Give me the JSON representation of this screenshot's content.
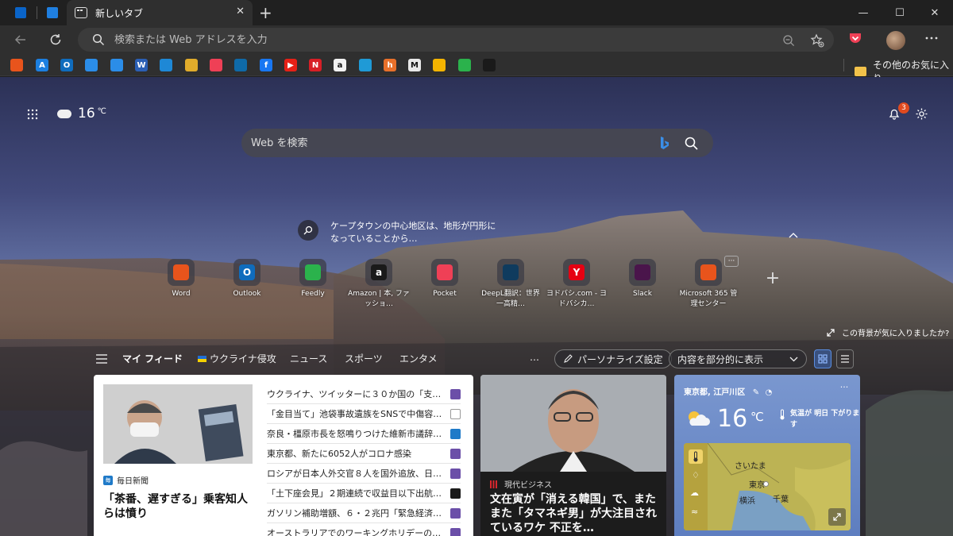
{
  "tab": {
    "title": "新しいタブ",
    "close": "✕",
    "new": "+"
  },
  "window": {
    "minimize": "—",
    "maximize": "☐",
    "close": "✕"
  },
  "address": {
    "placeholder": "検索または Web アドレスを入力"
  },
  "favorites": {
    "items": [
      {
        "name": "office",
        "letter": "",
        "color": "#e8541c"
      },
      {
        "name": "azure",
        "letter": "A",
        "color": "#1c7fe0"
      },
      {
        "name": "outlook",
        "letter": "O",
        "color": "#0f6cbd"
      },
      {
        "name": "onedrive-1",
        "letter": "",
        "color": "#2b8de8"
      },
      {
        "name": "onedrive-2",
        "letter": "",
        "color": "#2b8de8"
      },
      {
        "name": "word",
        "letter": "W",
        "color": "#2b5fb4"
      },
      {
        "name": "remote-desktop",
        "letter": "",
        "color": "#1e88d6"
      },
      {
        "name": "slack",
        "letter": "",
        "color": "#e1ac2b"
      },
      {
        "name": "pocket",
        "letter": "",
        "color": "#ef4056"
      },
      {
        "name": "deepl",
        "letter": "",
        "color": "#0f6aa8"
      },
      {
        "name": "facebook",
        "letter": "f",
        "color": "#1877f2"
      },
      {
        "name": "youtube",
        "letter": "▶",
        "color": "#e62117"
      },
      {
        "name": "netflix",
        "letter": "N",
        "color": "#d81f26"
      },
      {
        "name": "amazon",
        "letter": "a",
        "color": "#f2f2f2"
      },
      {
        "name": "kindle",
        "letter": "",
        "color": "#1f9ad6"
      },
      {
        "name": "hatena",
        "letter": "h",
        "color": "#e8702a"
      },
      {
        "name": "gmail",
        "letter": "M",
        "color": "#e8e8e8"
      },
      {
        "name": "google-drive",
        "letter": "",
        "color": "#f4b400"
      },
      {
        "name": "feedly",
        "letter": "",
        "color": "#2bb24c"
      },
      {
        "name": "microphone",
        "letter": "",
        "color": "#1a1a1a"
      }
    ],
    "other_label": "その他のお気に入り"
  },
  "ntp": {
    "weather_temp": "16",
    "weather_unit": "℃",
    "notification_count": "3",
    "search_placeholder": "Web を検索",
    "image_caption": "ケープタウンの中心地区は、地形が円形になっていることから…",
    "liked_text": "この背景が気に入りましたか?",
    "tiles": [
      {
        "label": "Word",
        "letter": "",
        "color": "#e8541c"
      },
      {
        "label": "Outlook",
        "letter": "O",
        "color": "#0f6cbd"
      },
      {
        "label": "Feedly",
        "letter": "",
        "color": "#2bb24c"
      },
      {
        "label": "Amazon | 本, ファッショ…",
        "letter": "a",
        "color": "#1a1a1a"
      },
      {
        "label": "Pocket",
        "letter": "",
        "color": "#ef4056"
      },
      {
        "label": "DeepL翻訳：世界一高精…",
        "letter": "",
        "color": "#0f3b5e"
      },
      {
        "label": "ヨドバシ.com - ヨドバシカ…",
        "letter": "Y",
        "color": "#e60012"
      },
      {
        "label": "Slack",
        "letter": "",
        "color": "#4a154b"
      },
      {
        "label": "Microsoft 365 管理センター",
        "letter": "",
        "color": "#e8541c"
      }
    ]
  },
  "feed": {
    "nav": [
      "マイ フィード",
      "ウクライナ侵攻",
      "ニュース",
      "スポーツ",
      "エンタメ"
    ],
    "more": "…",
    "personalize": "パーソナライズ設定",
    "content_select": "内容を部分的に表示"
  },
  "card_main": {
    "source": "毎日新聞",
    "headline": "「茶番、遅すぎる」乗客知人らは憤り",
    "list": [
      {
        "title": "ウクライナ、ツイッターに３０か国の「支…",
        "src_color": "#6b4fa8"
      },
      {
        "title": "「金目当て」池袋事故遺族をSNSで中傷容…",
        "src_color": "#ffffff"
      },
      {
        "title": "奈良・橿原市長を怒鳴りつけた維新市議辞…",
        "src_color": "#1f7ac8"
      },
      {
        "title": "東京都、新たに6052人がコロナ感染",
        "src_color": "#6b4fa8"
      },
      {
        "title": "ロシアが日本人外交官８人を国外追放、日…",
        "src_color": "#6b4fa8"
      },
      {
        "title": "「土下座会見」２期連続で収益目以下出航…",
        "src_color": "#1a1a1a"
      },
      {
        "title": "ガソリン補助増額、６・２兆円「緊急経済…",
        "src_color": "#6b4fa8"
      },
      {
        "title": "オーストラリアでのワーキングホリデーの…",
        "src_color": "#6b4fa8"
      }
    ]
  },
  "card_2": {
    "source": "現代ビジネス",
    "headline": "文在寅が「消える韓国」で、またまた「タマネギ男」が大注目されているワケ 不正を…"
  },
  "card_weather": {
    "location": "東京都, 江戸川区",
    "temp": "16",
    "unit": "℃",
    "note": "気温が 明日 下がります",
    "map_labels": [
      "さいたま",
      "東京",
      "千葉",
      "横浜"
    ]
  }
}
